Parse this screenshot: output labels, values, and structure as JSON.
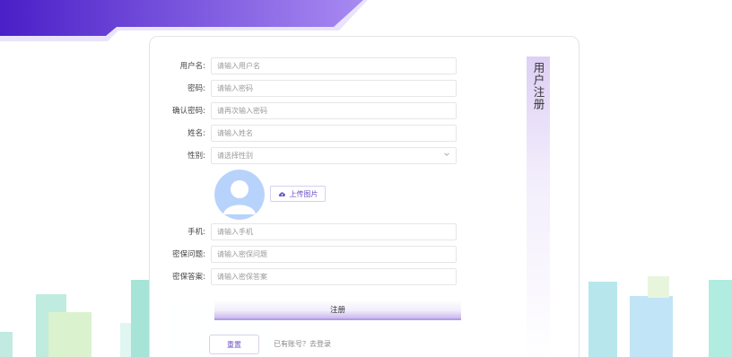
{
  "form": {
    "fields": [
      {
        "label": "用户名:",
        "placeholder": "请输入用户名"
      },
      {
        "label": "密码:",
        "placeholder": "请输入密码"
      },
      {
        "label": "确认密码:",
        "placeholder": "请再次输入密码"
      },
      {
        "label": "姓名:",
        "placeholder": "请输入姓名"
      }
    ],
    "gender": {
      "label": "性别:",
      "placeholder": "请选择性别"
    },
    "upload_label": "上传图片",
    "contact_fields": [
      {
        "label": "手机:",
        "placeholder": "请输入手机"
      },
      {
        "label": "密保问题:",
        "placeholder": "请输入密保问题"
      },
      {
        "label": "密保答案:",
        "placeholder": "请输入密保答案"
      }
    ],
    "submit_label": "注册",
    "reset_label": "重置",
    "login_link": "已有账号？去登录"
  },
  "side_title": "用户注册",
  "colors": {
    "banner_start": "#5b2fd6",
    "banner_end": "#a583f0",
    "accent": "#6b4fc7",
    "city_teal": "#6fd6c2",
    "avatar_bg": "#b8d3fb"
  },
  "icons": {
    "upload": "cloud-upload-icon",
    "select_arrow": "chevron-down-icon"
  }
}
